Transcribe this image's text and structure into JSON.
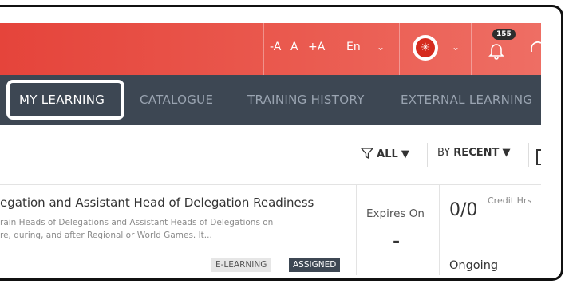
{
  "topbar": {
    "font_decrease": "-A",
    "font_normal": "A",
    "font_increase": "+A",
    "language": "En",
    "notification_count": "155",
    "accent_color": "#e5443b"
  },
  "nav": {
    "items": [
      {
        "label": "MY LEARNING",
        "active": true
      },
      {
        "label": "CATALOGUE",
        "active": false
      },
      {
        "label": "TRAINING HISTORY",
        "active": false
      },
      {
        "label": "EXTERNAL LEARNING",
        "active": false
      }
    ],
    "color": "#3d4753"
  },
  "filters": {
    "type_label": "ALL",
    "sort_prefix": "BY",
    "sort_value": "RECENT"
  },
  "course": {
    "title": "egation and Assistant Head of Delegation Readiness",
    "description_line1": "rain Heads of Delegations and Assistant Heads of Delegations on",
    "description_line2": "re, during, and after Regional or World Games. It...",
    "tag_type": "E-LEARNING",
    "tag_status": "ASSIGNED",
    "expires_label": "Expires On",
    "expires_value": "-",
    "progress": "0/0",
    "credit_label": "Credit Hrs",
    "status": "Ongoing"
  }
}
